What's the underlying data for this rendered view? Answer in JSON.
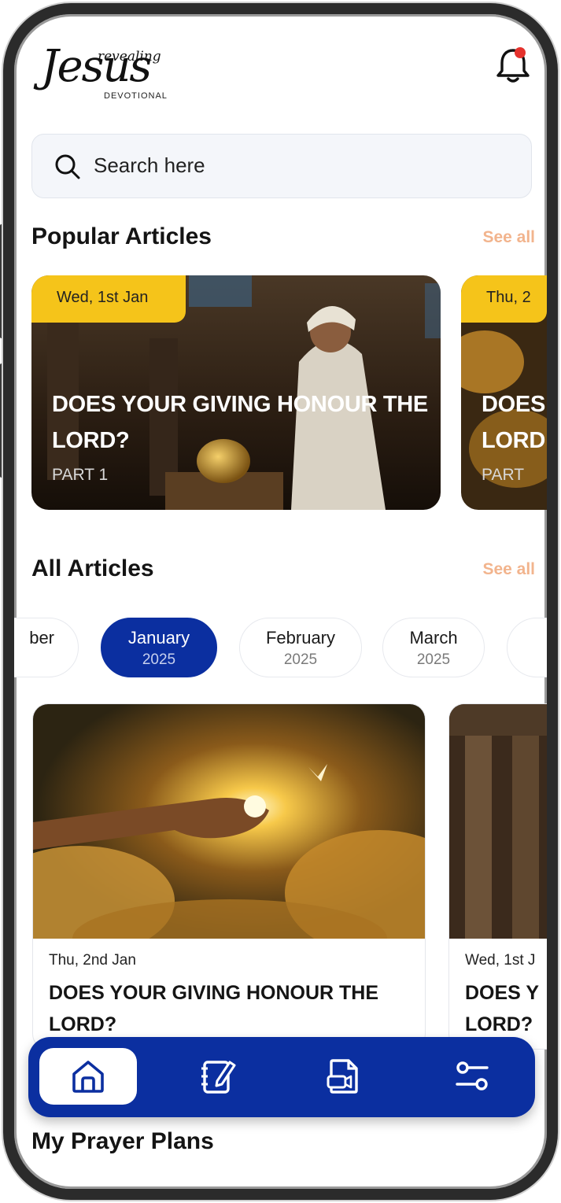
{
  "header": {
    "logo_word": "Jesus",
    "logo_top": "revealing",
    "logo_bottom": "DEVOTIONAL",
    "notification_icon": "bell-icon"
  },
  "search": {
    "placeholder": "Search here",
    "icon": "search-icon"
  },
  "popular": {
    "title": "Popular Articles",
    "see_all": "See all",
    "cards": [
      {
        "date": "Wed, 1st Jan",
        "title_line1": "DOES YOUR GIVING HONOUR THE",
        "title_line2": "LORD?",
        "part": "PART 1"
      },
      {
        "date": "Thu, 2",
        "title_line1": "DOES",
        "title_line2": "LORD",
        "part": "PART"
      }
    ]
  },
  "all_articles": {
    "title": "All Articles",
    "see_all": "See all",
    "months": [
      {
        "label": "ber",
        "year": ""
      },
      {
        "label": "January",
        "year": "2025",
        "active": true
      },
      {
        "label": "February",
        "year": "2025"
      },
      {
        "label": "March",
        "year": "2025"
      }
    ],
    "cards": [
      {
        "date": "Thu, 2nd Jan",
        "title_line1": "DOES YOUR GIVING HONOUR THE",
        "title_line2": "LORD?"
      },
      {
        "date": "Wed, 1st J",
        "title_line1": "DOES Y",
        "title_line2": "LORD?"
      }
    ]
  },
  "nav": {
    "items": [
      {
        "icon": "home-icon",
        "active": true
      },
      {
        "icon": "notebook-edit-icon"
      },
      {
        "icon": "video-file-icon"
      },
      {
        "icon": "settings-sliders-icon"
      }
    ]
  },
  "prayer_plans": {
    "title": "My Prayer Plans"
  },
  "colors": {
    "primary": "#0b2fa0",
    "accent_yellow": "#f5c41a",
    "see_all": "#f2b48d",
    "notification_dot": "#e5322d"
  }
}
